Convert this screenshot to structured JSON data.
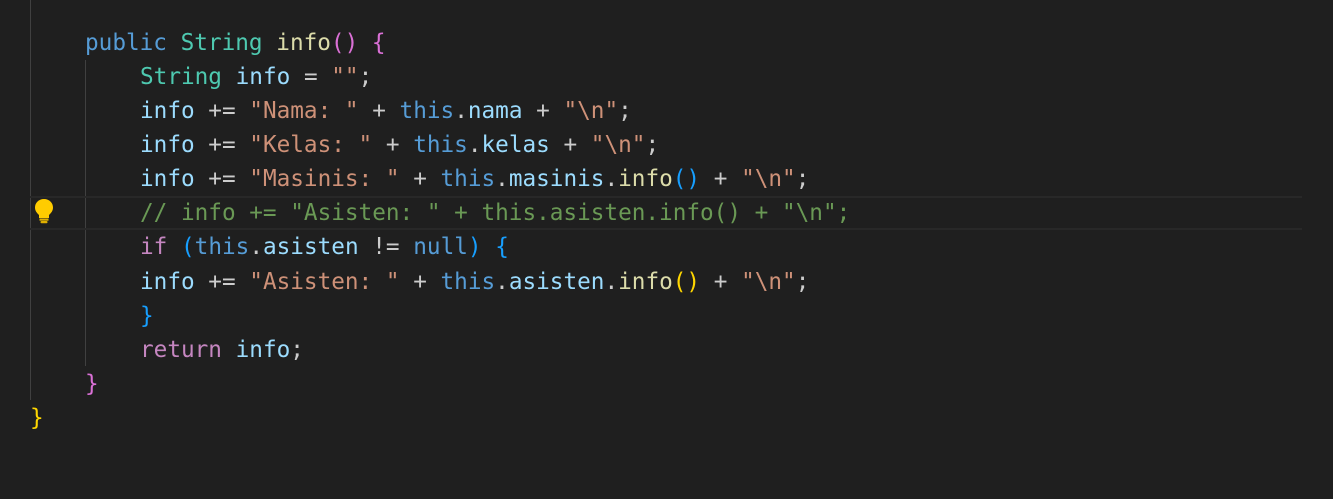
{
  "theme": {
    "background": "#1f1f1f",
    "colors": {
      "keyword": "#569cd6",
      "control": "#c586c0",
      "type": "#4ec9b0",
      "function": "#dcdcaa",
      "variable": "#9cdcfe",
      "string": "#ce9178",
      "comment": "#6a9955",
      "punct": "#cccccc",
      "bracket_gold": "#ffd700",
      "bracket_pink": "#da70d6",
      "bracket_blue": "#179fff"
    }
  },
  "gutter": {
    "icon": "lightbulb-icon",
    "line": 5
  },
  "code": {
    "lines": [
      {
        "name": "method-signature",
        "tokens": [
          {
            "t": "public",
            "c": "keyword"
          },
          {
            "t": " ",
            "c": "punct"
          },
          {
            "t": "String",
            "c": "type"
          },
          {
            "t": " ",
            "c": "punct"
          },
          {
            "t": "info",
            "c": "function"
          },
          {
            "t": "()",
            "c": "bracket_pink"
          },
          {
            "t": " ",
            "c": "punct"
          },
          {
            "t": "{",
            "c": "bracket_pink"
          }
        ]
      },
      {
        "name": "declare-info",
        "tokens": [
          {
            "t": "String",
            "c": "type"
          },
          {
            "t": " ",
            "c": "punct"
          },
          {
            "t": "info",
            "c": "variable"
          },
          {
            "t": " = ",
            "c": "punct"
          },
          {
            "t": "\"\"",
            "c": "string"
          },
          {
            "t": ";",
            "c": "punct"
          }
        ]
      },
      {
        "name": "append-nama",
        "tokens": [
          {
            "t": "info",
            "c": "variable"
          },
          {
            "t": " += ",
            "c": "punct"
          },
          {
            "t": "\"Nama: \"",
            "c": "string"
          },
          {
            "t": " + ",
            "c": "punct"
          },
          {
            "t": "this",
            "c": "keyword"
          },
          {
            "t": ".",
            "c": "punct"
          },
          {
            "t": "nama",
            "c": "variable"
          },
          {
            "t": " + ",
            "c": "punct"
          },
          {
            "t": "\"\\n\"",
            "c": "string"
          },
          {
            "t": ";",
            "c": "punct"
          }
        ]
      },
      {
        "name": "append-kelas",
        "tokens": [
          {
            "t": "info",
            "c": "variable"
          },
          {
            "t": " += ",
            "c": "punct"
          },
          {
            "t": "\"Kelas: \"",
            "c": "string"
          },
          {
            "t": " + ",
            "c": "punct"
          },
          {
            "t": "this",
            "c": "keyword"
          },
          {
            "t": ".",
            "c": "punct"
          },
          {
            "t": "kelas",
            "c": "variable"
          },
          {
            "t": " + ",
            "c": "punct"
          },
          {
            "t": "\"\\n\"",
            "c": "string"
          },
          {
            "t": ";",
            "c": "punct"
          }
        ]
      },
      {
        "name": "append-masinis",
        "tokens": [
          {
            "t": "info",
            "c": "variable"
          },
          {
            "t": " += ",
            "c": "punct"
          },
          {
            "t": "\"Masinis: \"",
            "c": "string"
          },
          {
            "t": " + ",
            "c": "punct"
          },
          {
            "t": "this",
            "c": "keyword"
          },
          {
            "t": ".",
            "c": "punct"
          },
          {
            "t": "masinis",
            "c": "variable"
          },
          {
            "t": ".",
            "c": "punct"
          },
          {
            "t": "info",
            "c": "function"
          },
          {
            "t": "()",
            "c": "bracket_blue"
          },
          {
            "t": " + ",
            "c": "punct"
          },
          {
            "t": "\"\\n\"",
            "c": "string"
          },
          {
            "t": ";",
            "c": "punct"
          }
        ]
      },
      {
        "name": "comment-asisten",
        "tokens": [
          {
            "t": "// info += \"Asisten: \" + this.asisten.info() + \"\\n\";",
            "c": "comment"
          }
        ]
      },
      {
        "name": "if-asisten",
        "tokens": [
          {
            "t": "if",
            "c": "control"
          },
          {
            "t": " ",
            "c": "punct"
          },
          {
            "t": "(",
            "c": "bracket_blue"
          },
          {
            "t": "this",
            "c": "keyword"
          },
          {
            "t": ".",
            "c": "punct"
          },
          {
            "t": "asisten",
            "c": "variable"
          },
          {
            "t": " != ",
            "c": "punct"
          },
          {
            "t": "null",
            "c": "keyword"
          },
          {
            "t": ")",
            "c": "bracket_blue"
          },
          {
            "t": " ",
            "c": "punct"
          },
          {
            "t": "{",
            "c": "bracket_blue"
          }
        ]
      },
      {
        "name": "append-asisten",
        "tokens": [
          {
            "t": "info",
            "c": "variable"
          },
          {
            "t": " += ",
            "c": "punct"
          },
          {
            "t": "\"Asisten: \"",
            "c": "string"
          },
          {
            "t": " + ",
            "c": "punct"
          },
          {
            "t": "this",
            "c": "keyword"
          },
          {
            "t": ".",
            "c": "punct"
          },
          {
            "t": "asisten",
            "c": "variable"
          },
          {
            "t": ".",
            "c": "punct"
          },
          {
            "t": "info",
            "c": "function"
          },
          {
            "t": "()",
            "c": "bracket_gold"
          },
          {
            "t": " + ",
            "c": "punct"
          },
          {
            "t": "\"\\n\"",
            "c": "string"
          },
          {
            "t": ";",
            "c": "punct"
          }
        ]
      },
      {
        "name": "close-if",
        "tokens": [
          {
            "t": "}",
            "c": "bracket_blue"
          }
        ]
      },
      {
        "name": "return-info",
        "tokens": [
          {
            "t": "return",
            "c": "control"
          },
          {
            "t": " ",
            "c": "punct"
          },
          {
            "t": "info",
            "c": "variable"
          },
          {
            "t": ";",
            "c": "punct"
          }
        ]
      },
      {
        "name": "close-method",
        "tokens": [
          {
            "t": "}",
            "c": "bracket_pink"
          }
        ]
      },
      {
        "name": "close-class",
        "tokens": [
          {
            "t": "}",
            "c": "bracket_gold"
          }
        ]
      }
    ]
  }
}
